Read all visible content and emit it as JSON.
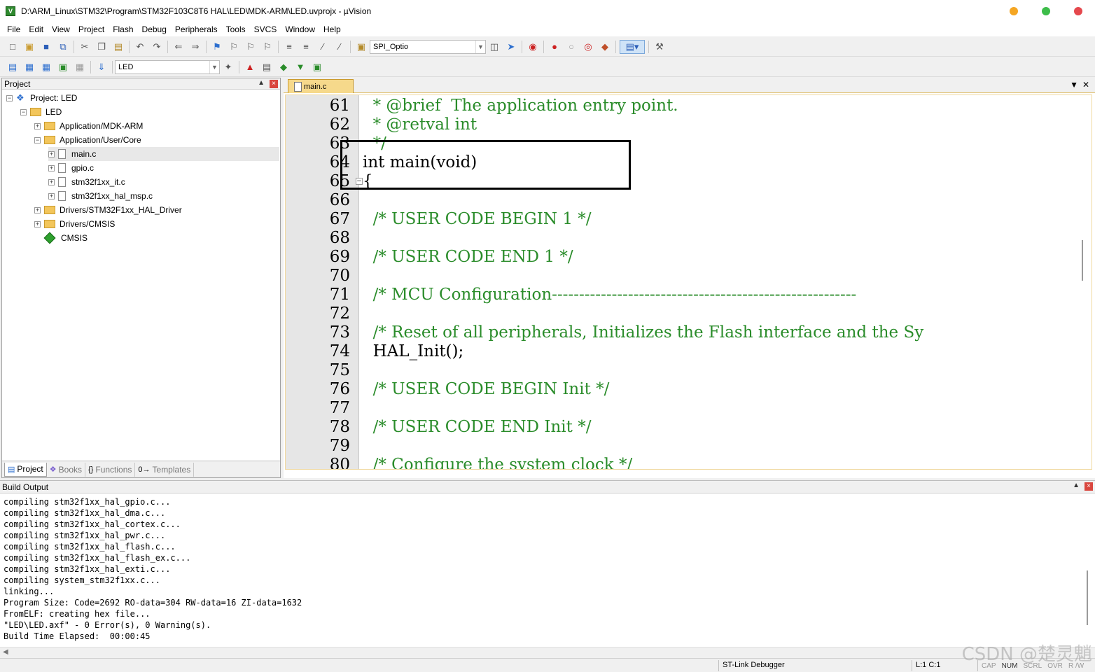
{
  "window": {
    "title": "D:\\ARM_Linux\\STM32\\Program\\STM32F103C8T6 HAL\\LED\\MDK-ARM\\LED.uvprojx - µVision",
    "icon_letter": "V",
    "controls": {
      "minimize_color": "#f5a623",
      "maximize_color": "#3dbd4a",
      "close_color": "#e5484d"
    }
  },
  "menu": [
    "File",
    "Edit",
    "View",
    "Project",
    "Flash",
    "Debug",
    "Peripherals",
    "Tools",
    "SVCS",
    "Window",
    "Help"
  ],
  "toolbar1": {
    "target_combo": "SPI_Optio"
  },
  "toolbar2": {
    "target_name": "LED"
  },
  "project_panel": {
    "title": "Project",
    "tree": [
      {
        "label": "Project: LED",
        "icon": "project-icon"
      },
      {
        "label": "LED",
        "icon": "target-folder-icon"
      },
      {
        "label": "Application/MDK-ARM",
        "icon": "folder-icon"
      },
      {
        "label": "Application/User/Core",
        "icon": "folder-icon"
      },
      {
        "label": "main.c",
        "icon": "file-icon"
      },
      {
        "label": "gpio.c",
        "icon": "file-icon"
      },
      {
        "label": "stm32f1xx_it.c",
        "icon": "file-icon"
      },
      {
        "label": "stm32f1xx_hal_msp.c",
        "icon": "file-icon"
      },
      {
        "label": "Drivers/STM32F1xx_HAL_Driver",
        "icon": "folder-icon"
      },
      {
        "label": "Drivers/CMSIS",
        "icon": "folder-icon"
      },
      {
        "label": "CMSIS",
        "icon": "diamond-icon"
      }
    ],
    "tabs": [
      {
        "label": "Project",
        "icon": "project-tab-icon"
      },
      {
        "label": "Books",
        "icon": "books-icon"
      },
      {
        "label": "Functions",
        "icon": "braces-icon"
      },
      {
        "label": "Templates",
        "icon": "template-icon"
      }
    ]
  },
  "editor": {
    "active_tab": "main.c",
    "comment_color": "#2a8c2a",
    "lines": [
      {
        "num": "61",
        "text": "  * @brief  The application entry point.",
        "kind": "cmt"
      },
      {
        "num": "62",
        "text": "  * @retval int",
        "kind": "cmt"
      },
      {
        "num": "63",
        "text": "  */",
        "kind": "cmt"
      },
      {
        "num": "64",
        "text": "int main(void)",
        "kind": "plain"
      },
      {
        "num": "65",
        "text": "{",
        "kind": "plain"
      },
      {
        "num": "66",
        "text": "",
        "kind": "plain"
      },
      {
        "num": "67",
        "text": "  /* USER CODE BEGIN 1 */",
        "kind": "cmt"
      },
      {
        "num": "68",
        "text": "",
        "kind": "plain"
      },
      {
        "num": "69",
        "text": "  /* USER CODE END 1 */",
        "kind": "cmt"
      },
      {
        "num": "70",
        "text": "",
        "kind": "plain"
      },
      {
        "num": "71",
        "text": "  /* MCU Configuration--------------------------------------------------------",
        "kind": "cmt"
      },
      {
        "num": "72",
        "text": "",
        "kind": "plain"
      },
      {
        "num": "73",
        "text": "  /* Reset of all peripherals, Initializes the Flash interface and the Sy",
        "kind": "cmt"
      },
      {
        "num": "74",
        "text": "  HAL_Init();",
        "kind": "plain"
      },
      {
        "num": "75",
        "text": "",
        "kind": "plain"
      },
      {
        "num": "76",
        "text": "  /* USER CODE BEGIN Init */",
        "kind": "cmt"
      },
      {
        "num": "77",
        "text": "",
        "kind": "plain"
      },
      {
        "num": "78",
        "text": "  /* USER CODE END Init */",
        "kind": "cmt"
      },
      {
        "num": "79",
        "text": "",
        "kind": "plain"
      },
      {
        "num": "80",
        "text": "  /* Configure the system clock */",
        "kind": "cmt"
      }
    ]
  },
  "build_output": {
    "title": "Build Output",
    "log": [
      "compiling stm32f1xx_hal_gpio.c...",
      "compiling stm32f1xx_hal_dma.c...",
      "compiling stm32f1xx_hal_cortex.c...",
      "compiling stm32f1xx_hal_pwr.c...",
      "compiling stm32f1xx_hal_flash.c...",
      "compiling stm32f1xx_hal_flash_ex.c...",
      "compiling stm32f1xx_hal_exti.c...",
      "compiling system_stm32f1xx.c...",
      "linking...",
      "Program Size: Code=2692 RO-data=304 RW-data=16 ZI-data=1632",
      "FromELF: creating hex file...",
      "\"LED\\LED.axf\" - 0 Error(s), 0 Warning(s).",
      "Build Time Elapsed:  00:00:45"
    ]
  },
  "status_bar": {
    "debugger": "ST-Link Debugger",
    "cursor": "L:1 C:1",
    "indicators": [
      "CAP",
      "NUM",
      "SCRL",
      "OVR",
      "R /W"
    ]
  },
  "watermark": "CSDN @楚灵魈"
}
